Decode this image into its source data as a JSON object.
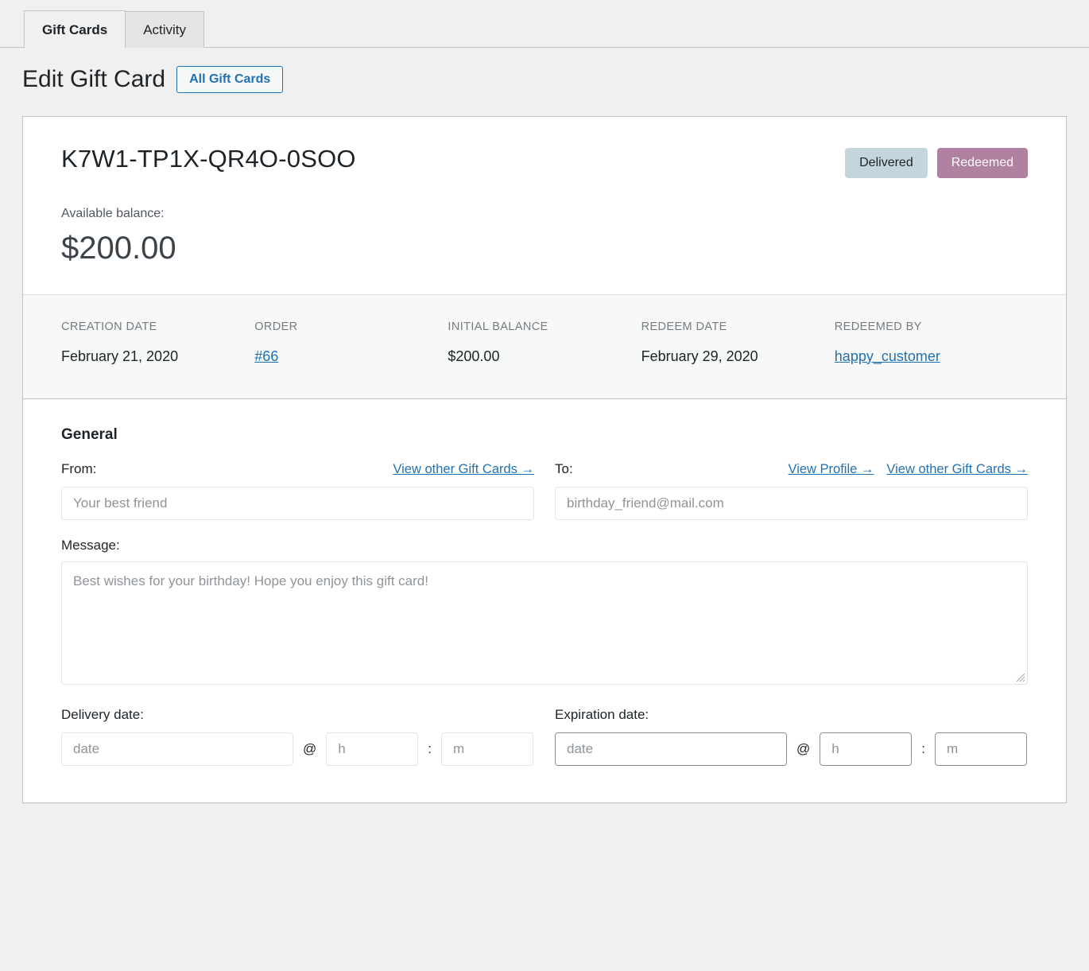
{
  "tabs": [
    {
      "label": "Gift Cards",
      "active": true
    },
    {
      "label": "Activity",
      "active": false
    }
  ],
  "header": {
    "title": "Edit Gift Card",
    "all_gift_cards_button": "All Gift Cards"
  },
  "card": {
    "code": "K7W1-TP1X-QR4O-0SOO",
    "badges": [
      {
        "label": "Delivered",
        "bg": "#c5d5dd",
        "fg": "#1d2327"
      },
      {
        "label": "Redeemed",
        "bg": "#b081a0",
        "fg": "#ffffff"
      }
    ],
    "available_balance_label": "Available balance:",
    "available_balance_value": "$200.00"
  },
  "meta": [
    {
      "label": "CREATION DATE",
      "value": "February 21, 2020",
      "link": false
    },
    {
      "label": "ORDER",
      "value": "#66",
      "link": true
    },
    {
      "label": "INITIAL BALANCE",
      "value": "$200.00",
      "link": false
    },
    {
      "label": "REDEEM DATE",
      "value": "February 29, 2020",
      "link": false
    },
    {
      "label": "REDEEMED BY",
      "value": "happy_customer",
      "link": true
    }
  ],
  "general": {
    "section_title": "General",
    "from": {
      "label": "From:",
      "placeholder": "Your best friend",
      "value": "",
      "links": [
        "View other Gift Cards →"
      ]
    },
    "to": {
      "label": "To:",
      "placeholder": "birthday_friend@mail.com",
      "value": "",
      "links": [
        "View Profile →",
        "View other Gift Cards →"
      ]
    },
    "message": {
      "label": "Message:",
      "placeholder": "Best wishes for your birthday! Hope you enjoy this gift card!",
      "value": ""
    },
    "delivery_date": {
      "label": "Delivery date:",
      "date_placeholder": "date",
      "hour_placeholder": "h",
      "minute_placeholder": "m",
      "at_symbol": "@",
      "time_separator": ":"
    },
    "expiration_date": {
      "label": "Expiration date:",
      "date_placeholder": "date",
      "hour_placeholder": "h",
      "minute_placeholder": "m",
      "at_symbol": "@",
      "time_separator": ":"
    }
  },
  "colors": {
    "page_background": "#f0f0f1",
    "card_background": "#ffffff",
    "border": "#c3c4c7",
    "link": "#2271b1",
    "meta_strip_background": "#f7f8f8"
  }
}
